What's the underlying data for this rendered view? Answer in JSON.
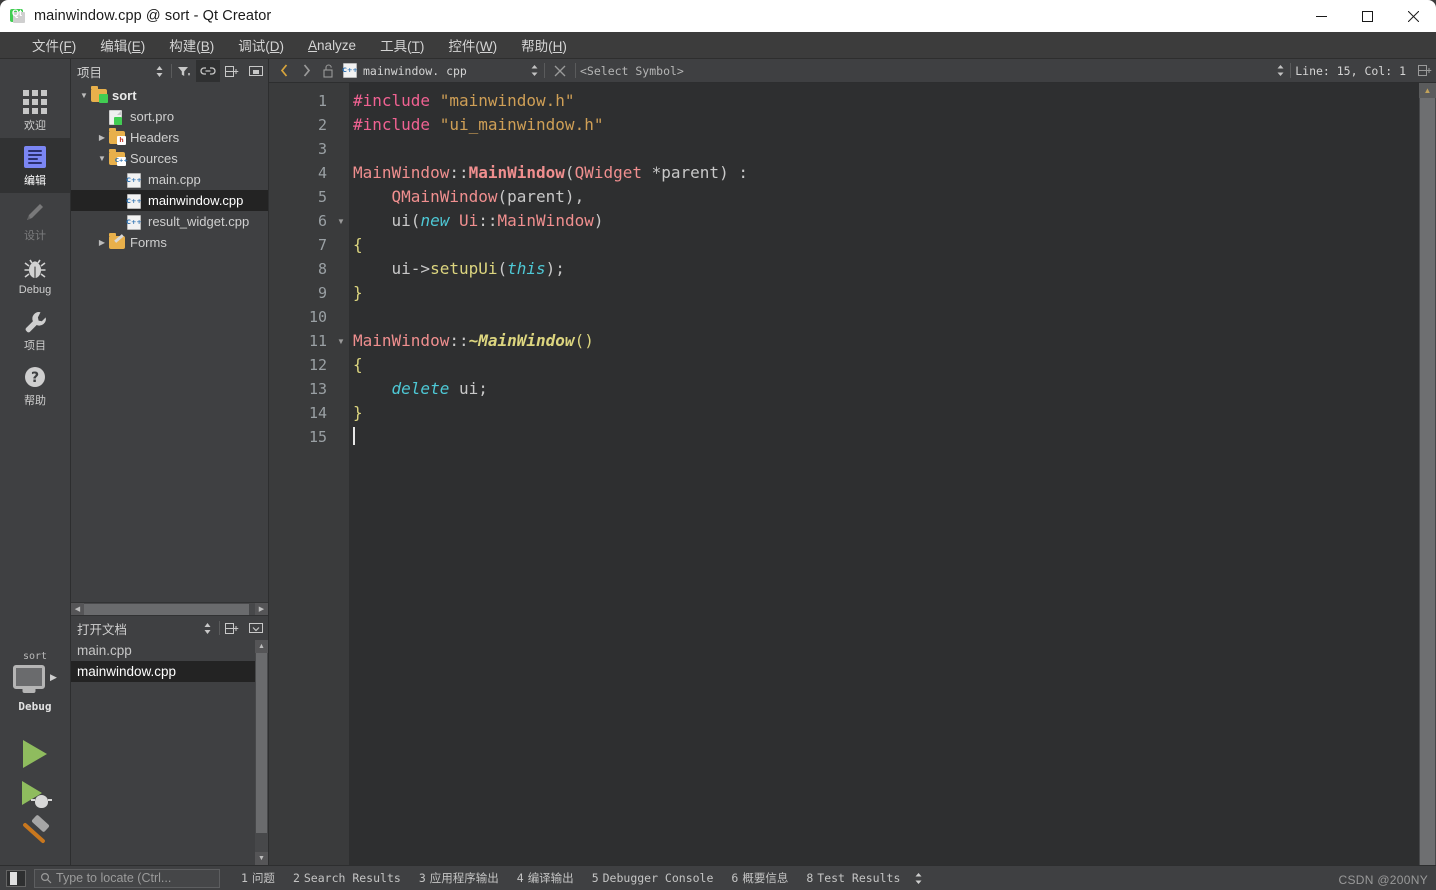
{
  "window": {
    "title": "mainwindow.cpp @ sort - Qt Creator",
    "minimize_label": "Minimize",
    "maximize_label": "Maximize",
    "close_label": "Close"
  },
  "menubar": {
    "items": [
      {
        "label": "文件(F)",
        "text": "文件(",
        "accel": "F",
        "tail": ")"
      },
      {
        "label": "编辑(E)",
        "text": "编辑(",
        "accel": "E",
        "tail": ")"
      },
      {
        "label": "构建(B)",
        "text": "构建(",
        "accel": "B",
        "tail": ")"
      },
      {
        "label": "调试(D)",
        "text": "调试(",
        "accel": "D",
        "tail": ")"
      },
      {
        "label": "Analyze",
        "text": "",
        "accel": "A",
        "tail": "nalyze"
      },
      {
        "label": "工具(T)",
        "text": "工具(",
        "accel": "T",
        "tail": ")"
      },
      {
        "label": "控件(W)",
        "text": "控件(",
        "accel": "W",
        "tail": ")"
      },
      {
        "label": "帮助(H)",
        "text": "帮助(",
        "accel": "H",
        "tail": ")"
      }
    ]
  },
  "modebar": {
    "items": [
      {
        "label": "欢迎",
        "icon": "grid-icon",
        "state": "normal"
      },
      {
        "label": "编辑",
        "icon": "edit-document-icon",
        "state": "active"
      },
      {
        "label": "设计",
        "icon": "pencil-icon",
        "state": "disabled"
      },
      {
        "label": "Debug",
        "icon": "bug-icon",
        "state": "normal"
      },
      {
        "label": "项目",
        "icon": "wrench-icon",
        "state": "normal"
      },
      {
        "label": "帮助",
        "icon": "question-circle-icon",
        "state": "normal"
      }
    ],
    "kit": {
      "project_name": "sort",
      "icon": "monitor-icon",
      "build_config": "Debug",
      "run_label": "Run",
      "debug_label": "Start Debugging",
      "build_label": "Build"
    }
  },
  "project_panel": {
    "title": "项目",
    "toolbar": [
      {
        "name": "sort-order-icon",
        "label": ""
      },
      {
        "name": "filter-icon",
        "label": ""
      },
      {
        "name": "link-sync-icon",
        "label": "",
        "active": true
      },
      {
        "name": "split-add-icon",
        "label": ""
      },
      {
        "name": "hide-sidebar-icon",
        "label": ""
      }
    ],
    "tree": [
      {
        "label": "sort",
        "indent": 0,
        "arrow": "down",
        "icon": "folder-qt-icon",
        "bold": true,
        "selected": false
      },
      {
        "label": "sort.pro",
        "indent": 1,
        "arrow": "none",
        "icon": "file-qt-icon",
        "bold": false,
        "selected": false
      },
      {
        "label": "Headers",
        "indent": 1,
        "arrow": "right",
        "icon": "folder-h-icon",
        "bold": false,
        "selected": false
      },
      {
        "label": "Sources",
        "indent": 1,
        "arrow": "down",
        "icon": "folder-cpp-icon",
        "bold": false,
        "selected": false
      },
      {
        "label": "main.cpp",
        "indent": 2,
        "arrow": "none",
        "icon": "file-cpp-icon",
        "bold": false,
        "selected": false
      },
      {
        "label": "mainwindow.cpp",
        "indent": 2,
        "arrow": "none",
        "icon": "file-cpp-icon",
        "bold": false,
        "selected": true
      },
      {
        "label": "result_widget.cpp",
        "indent": 2,
        "arrow": "none",
        "icon": "file-cpp-icon",
        "bold": false,
        "selected": false
      },
      {
        "label": "Forms",
        "indent": 1,
        "arrow": "right",
        "icon": "folder-ui-icon",
        "bold": false,
        "selected": false
      }
    ]
  },
  "open_documents": {
    "title": "打开文档",
    "toolbar": [
      {
        "name": "sort-order-icon"
      },
      {
        "name": "split-add-icon"
      },
      {
        "name": "hide-panel-icon"
      }
    ],
    "items": [
      {
        "label": "main.cpp",
        "selected": false
      },
      {
        "label": "mainwindow.cpp",
        "selected": true
      }
    ]
  },
  "editor_toolbar": {
    "back_label": "Go Back",
    "forward_label": "Go Forward",
    "lock_label": "Unlocked",
    "filename": "mainwindow. cpp",
    "close_label": "Close Document",
    "symbol_selector": "<Select Symbol>",
    "line_col": "Line: 15, Col: 1",
    "split_label": "Split"
  },
  "editor": {
    "lines": [
      {
        "num": "1",
        "fold": "",
        "tokens": [
          {
            "t": "#include ",
            "c": "k-pre"
          },
          {
            "t": "\"mainwindow.h\"",
            "c": "k-str"
          }
        ]
      },
      {
        "num": "2",
        "fold": "",
        "tokens": [
          {
            "t": "#include ",
            "c": "k-pre"
          },
          {
            "t": "\"ui_mainwindow.h\"",
            "c": "k-str"
          }
        ]
      },
      {
        "num": "3",
        "fold": "",
        "tokens": []
      },
      {
        "num": "4",
        "fold": "",
        "tokens": [
          {
            "t": "MainWindow",
            "c": "k-type"
          },
          {
            "t": "::",
            "c": "k-punct"
          },
          {
            "t": "MainWindow",
            "c": "k-ctor"
          },
          {
            "t": "(",
            "c": "k-punct"
          },
          {
            "t": "QWidget",
            "c": "k-type"
          },
          {
            "t": " *parent) :",
            "c": "k-plain"
          }
        ]
      },
      {
        "num": "5",
        "fold": "",
        "tokens": [
          {
            "t": "    ",
            "c": "k-plain"
          },
          {
            "t": "QMainWindow",
            "c": "k-type"
          },
          {
            "t": "(parent),",
            "c": "k-plain"
          }
        ]
      },
      {
        "num": "6",
        "fold": "down",
        "tokens": [
          {
            "t": "    ui(",
            "c": "k-plain"
          },
          {
            "t": "new",
            "c": "k-kw"
          },
          {
            "t": " ",
            "c": "k-plain"
          },
          {
            "t": "Ui",
            "c": "k-type"
          },
          {
            "t": "::",
            "c": "k-punct"
          },
          {
            "t": "MainWindow",
            "c": "k-type"
          },
          {
            "t": ")",
            "c": "k-plain"
          }
        ]
      },
      {
        "num": "7",
        "fold": "",
        "tokens": [
          {
            "t": "{",
            "c": "k-brace"
          }
        ]
      },
      {
        "num": "8",
        "fold": "",
        "tokens": [
          {
            "t": "    ui->",
            "c": "k-plain"
          },
          {
            "t": "setupUi",
            "c": "k-fn"
          },
          {
            "t": "(",
            "c": "k-plain"
          },
          {
            "t": "this",
            "c": "k-kw"
          },
          {
            "t": ");",
            "c": "k-plain"
          }
        ]
      },
      {
        "num": "9",
        "fold": "",
        "tokens": [
          {
            "t": "}",
            "c": "k-brace"
          }
        ]
      },
      {
        "num": "10",
        "fold": "",
        "tokens": []
      },
      {
        "num": "11",
        "fold": "down",
        "tokens": [
          {
            "t": "MainWindow",
            "c": "k-type"
          },
          {
            "t": "::",
            "c": "k-punct"
          },
          {
            "t": "~MainWindow",
            "c": "k-dtor"
          },
          {
            "t": "()",
            "c": "k-brace"
          }
        ]
      },
      {
        "num": "12",
        "fold": "",
        "tokens": [
          {
            "t": "{",
            "c": "k-brace"
          }
        ]
      },
      {
        "num": "13",
        "fold": "",
        "tokens": [
          {
            "t": "    ",
            "c": "k-plain"
          },
          {
            "t": "delete",
            "c": "k-kw"
          },
          {
            "t": " ui;",
            "c": "k-plain"
          }
        ]
      },
      {
        "num": "14",
        "fold": "",
        "tokens": [
          {
            "t": "}",
            "c": "k-brace"
          }
        ]
      },
      {
        "num": "15",
        "fold": "",
        "tokens": [],
        "cursor": true
      }
    ]
  },
  "statusbar": {
    "sidebar_toggle_label": "Toggle Sidebar",
    "locator_placeholder": "Type to locate (Ctrl...",
    "locator_value": "",
    "panes": [
      {
        "num": "1",
        "label": "问题"
      },
      {
        "num": "2",
        "label": "Search Results"
      },
      {
        "num": "3",
        "label": "应用程序输出"
      },
      {
        "num": "4",
        "label": "编译输出"
      },
      {
        "num": "5",
        "label": "Debugger Console"
      },
      {
        "num": "6",
        "label": "概要信息"
      },
      {
        "num": "8",
        "label": "Test Results"
      }
    ],
    "watermark": "CSDN @200NY"
  },
  "colors": {
    "accent_green": "#41cd52",
    "window_bg": "#3f4042",
    "editor_bg": "#2e2f30",
    "selection": "#232323",
    "folder": "#e8b04b",
    "preproc": "#f06292",
    "string": "#cf9f56",
    "type": "#f08f8f",
    "keyword": "#4ec9d6",
    "function": "#dcd57f"
  }
}
